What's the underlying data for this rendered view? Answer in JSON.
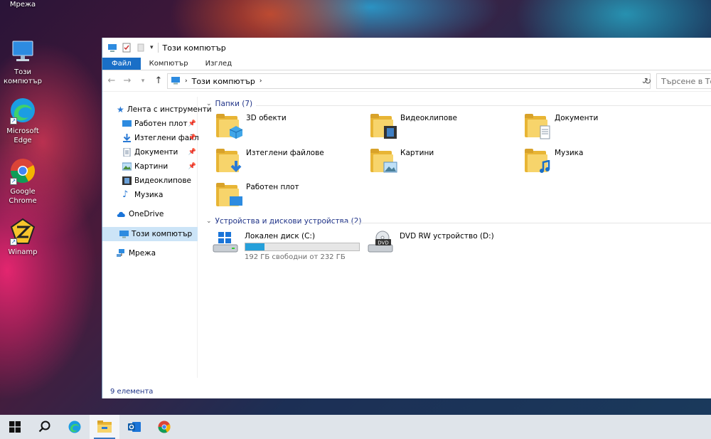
{
  "desktop": {
    "icons": [
      {
        "label": "Мрежа"
      },
      {
        "label": "Този компютър"
      },
      {
        "label": "Microsoft Edge"
      },
      {
        "label": "Google Chrome"
      },
      {
        "label": "Winamp"
      }
    ]
  },
  "window": {
    "title": "Този компютър",
    "ribbon_tabs": [
      "Файл",
      "Компютър",
      "Изглед"
    ],
    "address": {
      "path": "Този компютър"
    },
    "search": {
      "placeholder": "Търсене в Този компютър"
    },
    "nav": {
      "quick_access": "Лента с инструменти",
      "pinned": [
        {
          "label": "Работен плот"
        },
        {
          "label": "Изтеглени файл"
        },
        {
          "label": "Документи"
        },
        {
          "label": "Картини"
        }
      ],
      "unpinned": [
        {
          "label": "Видеоклипове"
        },
        {
          "label": "Музика"
        }
      ],
      "onedrive": "OneDrive",
      "this_pc": "Този компютър",
      "network": "Мрежа"
    },
    "folders_header": "Папки (7)",
    "folders": [
      {
        "name": "3D обекти"
      },
      {
        "name": "Видеоклипове"
      },
      {
        "name": "Документи"
      },
      {
        "name": "Изтеглени файлове"
      },
      {
        "name": "Картини"
      },
      {
        "name": "Музика"
      },
      {
        "name": "Работен плот"
      }
    ],
    "devices_header": "Устройства и дискови устройства (2)",
    "devices": [
      {
        "name": "Локален диск (C:)",
        "free": "192 ГБ свободни от 232 ГБ",
        "used_fraction": 0.17
      },
      {
        "name": "DVD RW устройство (D:)"
      }
    ],
    "status": "9 елемента"
  },
  "colors": {
    "accent": "#1a6fc7",
    "folder": "#f7d46b",
    "usage_bar": "#26a0da"
  }
}
